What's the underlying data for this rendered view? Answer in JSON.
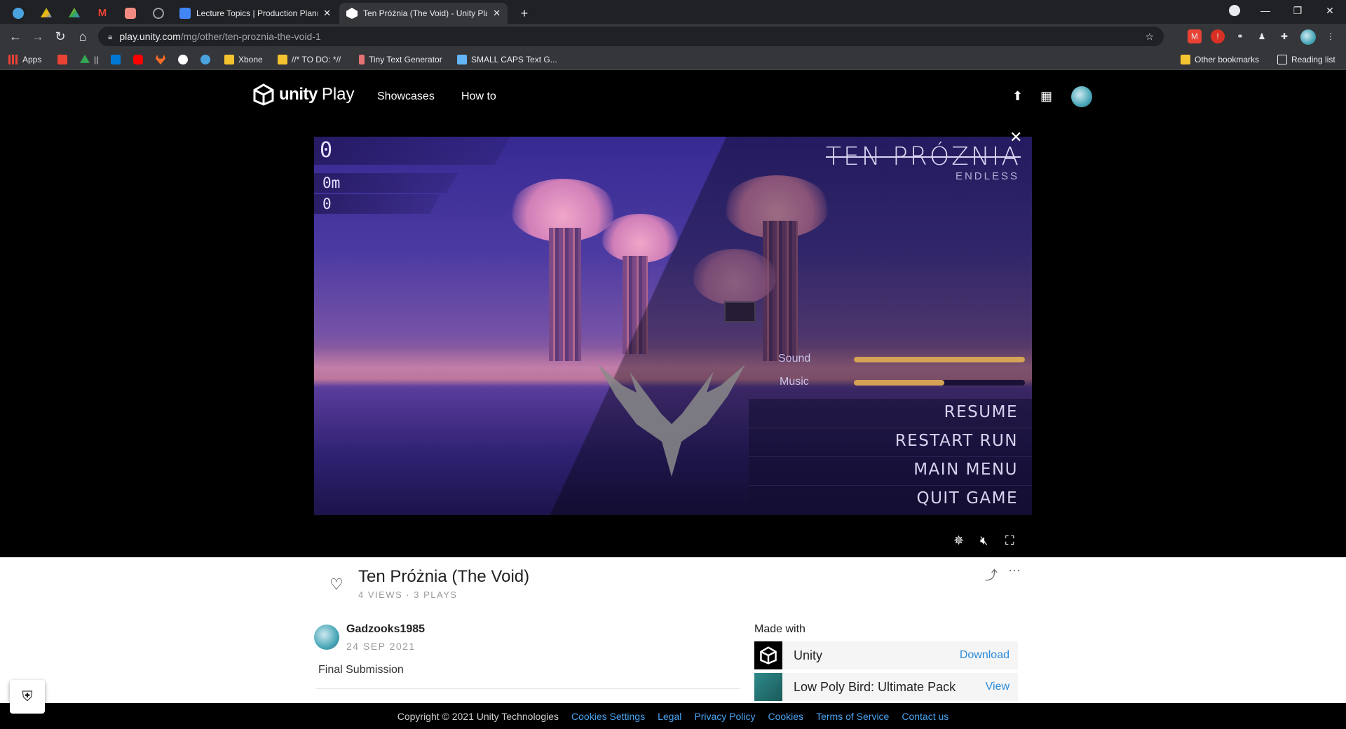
{
  "browser": {
    "tabs": [
      {
        "title": "",
        "icon": "edge-icon",
        "color": "#4aa3df"
      },
      {
        "title": "",
        "icon": "google-drive-icon",
        "color": "#34a853"
      },
      {
        "title": "",
        "icon": "google-drive-icon",
        "color": "#fbbc04"
      },
      {
        "title": "",
        "icon": "gmail-icon",
        "color": "#ea4335"
      },
      {
        "title": "",
        "icon": "app-icon",
        "color": "#f28b82"
      },
      {
        "title": "",
        "icon": "globe-icon",
        "color": "#9aa0a6"
      },
      {
        "title": "Lecture Topics | Production Plann",
        "icon": "google-docs-icon",
        "color": "#4285f4"
      },
      {
        "title": "Ten Próżnia (The Void) - Unity Pla",
        "icon": "unity-icon",
        "color": "#ffffff",
        "active": true
      }
    ],
    "url": {
      "host": "play.unity.com",
      "path": "/mg/other/ten-proznia-the-void-1"
    },
    "bookmarks": [
      {
        "label": "Apps",
        "icon": "apps-grid-icon",
        "color": "#ea4335"
      },
      {
        "label": "",
        "icon": "calendar-icon",
        "color": "#ea4335"
      },
      {
        "label": "||",
        "icon": "google-drive-icon",
        "color": "#34a853"
      },
      {
        "label": "",
        "icon": "outlook-icon",
        "color": "#0078d4"
      },
      {
        "label": "",
        "icon": "youtube-icon",
        "color": "#ff0000"
      },
      {
        "label": "",
        "icon": "gitlab-icon",
        "color": "#fc6d26"
      },
      {
        "label": "",
        "icon": "github-icon",
        "color": "#ffffff"
      },
      {
        "label": "",
        "icon": "edge-icon",
        "color": "#4aa3df"
      },
      {
        "label": "Xbone",
        "icon": "folder-icon",
        "color": "#f4c430"
      },
      {
        "label": "//* TO DO: *//",
        "icon": "folder-icon",
        "color": "#f4c430"
      },
      {
        "label": "Tiny Text Generator",
        "icon": "bookmark-icon",
        "color": "#e57373"
      },
      {
        "label": "SMALL CAPS Text G...",
        "icon": "bookmark-icon",
        "color": "#64b5f6"
      }
    ],
    "other_bookmarks": "Other bookmarks",
    "reading_list": "Reading list"
  },
  "site": {
    "logo_word1": "unity",
    "logo_word2": "Play",
    "nav": [
      "Showcases",
      "How to"
    ]
  },
  "game": {
    "score": "0",
    "distance": "0m",
    "counter": "0",
    "title": "TEN PRÓZNIA",
    "mode": "ENDLESS",
    "sound_label": "Sound",
    "music_label": "Music",
    "sound_level": 1.0,
    "music_level": 0.53,
    "menu": [
      "RESUME",
      "RESTART RUN",
      "MAIN MENU",
      "QUIT GAME"
    ]
  },
  "info": {
    "game_title": "Ten Próżnia (The Void)",
    "stats": "4 VIEWS · 3 PLAYS",
    "author": "Gadzooks1985",
    "date": "24 SEP 2021",
    "description": "Final Submission",
    "made_with_label": "Made with",
    "made_with": [
      {
        "name": "Unity",
        "action": "Download"
      },
      {
        "name": "Low Poly Bird: Ultimate Pack",
        "action": "View"
      }
    ]
  },
  "footer": {
    "copyright": "Copyright © 2021 Unity Technologies",
    "links": [
      "Cookies Settings",
      "Legal",
      "Privacy Policy",
      "Cookies",
      "Terms of Service",
      "Contact us"
    ]
  }
}
